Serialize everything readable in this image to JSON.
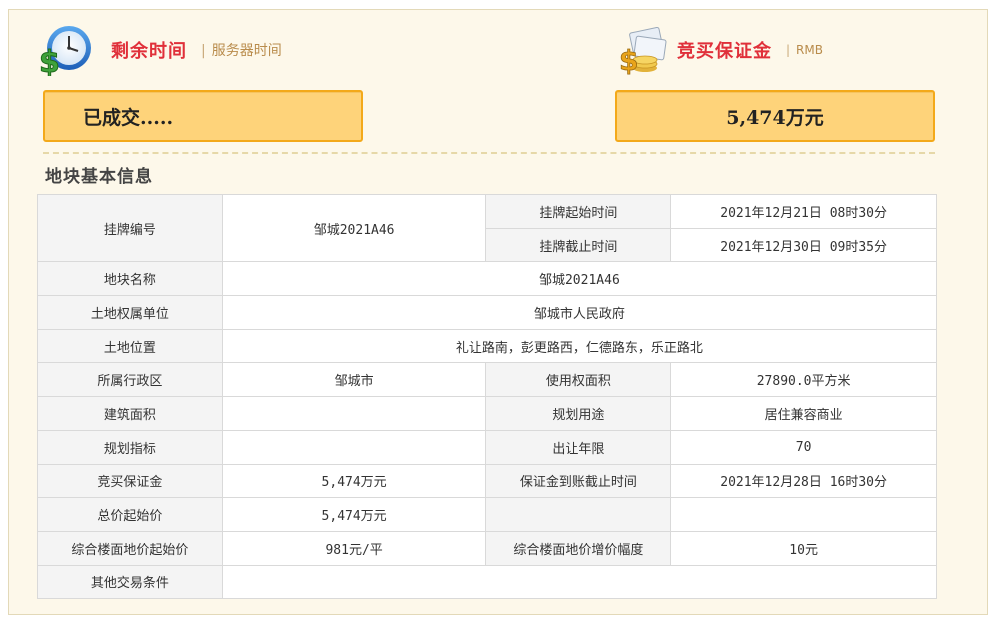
{
  "header": {
    "remaining_label": "剩余时间",
    "server_time_label": "服务器时间",
    "deposit_label": "竞买保证金",
    "currency_label": "RMB",
    "separator": "|"
  },
  "status": {
    "deal_text": "已成交.....",
    "deposit_amount": "5,474万元"
  },
  "section": {
    "title": "地块基本信息"
  },
  "colors": {
    "accent_red": "#e0303a",
    "box_fill": "#fed37a",
    "box_border": "#f3a91a"
  },
  "icons": {
    "left": "clock-dollar-icon",
    "right": "money-bag-icon"
  },
  "table": {
    "listing_no_label": "挂牌编号",
    "listing_no": "邹城2021A46",
    "start_time_label": "挂牌起始时间",
    "start_time": "2021年12月21日 08时30分",
    "end_time_label": "挂牌截止时间",
    "end_time": "2021年12月30日 09时35分",
    "parcel_name_label": "地块名称",
    "parcel_name": "邹城2021A46",
    "owner_label": "土地权属单位",
    "owner": "邹城市人民政府",
    "location_label": "土地位置",
    "location": "礼让路南，彭更路西，仁德路东，乐正路北",
    "district_label": "所属行政区",
    "district": "邹城市",
    "use_area_label": "使用权面积",
    "use_area": "27890.0平方米",
    "building_area_label": "建筑面积",
    "building_area": "",
    "planned_use_label": "规划用途",
    "planned_use": "居住兼容商业",
    "plan_index_label": "规划指标",
    "plan_index": "",
    "term_label": "出让年限",
    "term": "70",
    "deposit_label": "竞买保证金",
    "deposit": "5,474万元",
    "deposit_deadline_label": "保证金到账截止时间",
    "deposit_deadline": "2021年12月28日 16时30分",
    "start_price_label": "总价起始价",
    "start_price": "5,474万元",
    "floor_price_label": "综合楼面地价起始价",
    "floor_price": "981元/平",
    "floor_increment_label": "综合楼面地价增价幅度",
    "floor_increment": "10元",
    "other_conditions_label": "其他交易条件",
    "other_conditions": ""
  }
}
